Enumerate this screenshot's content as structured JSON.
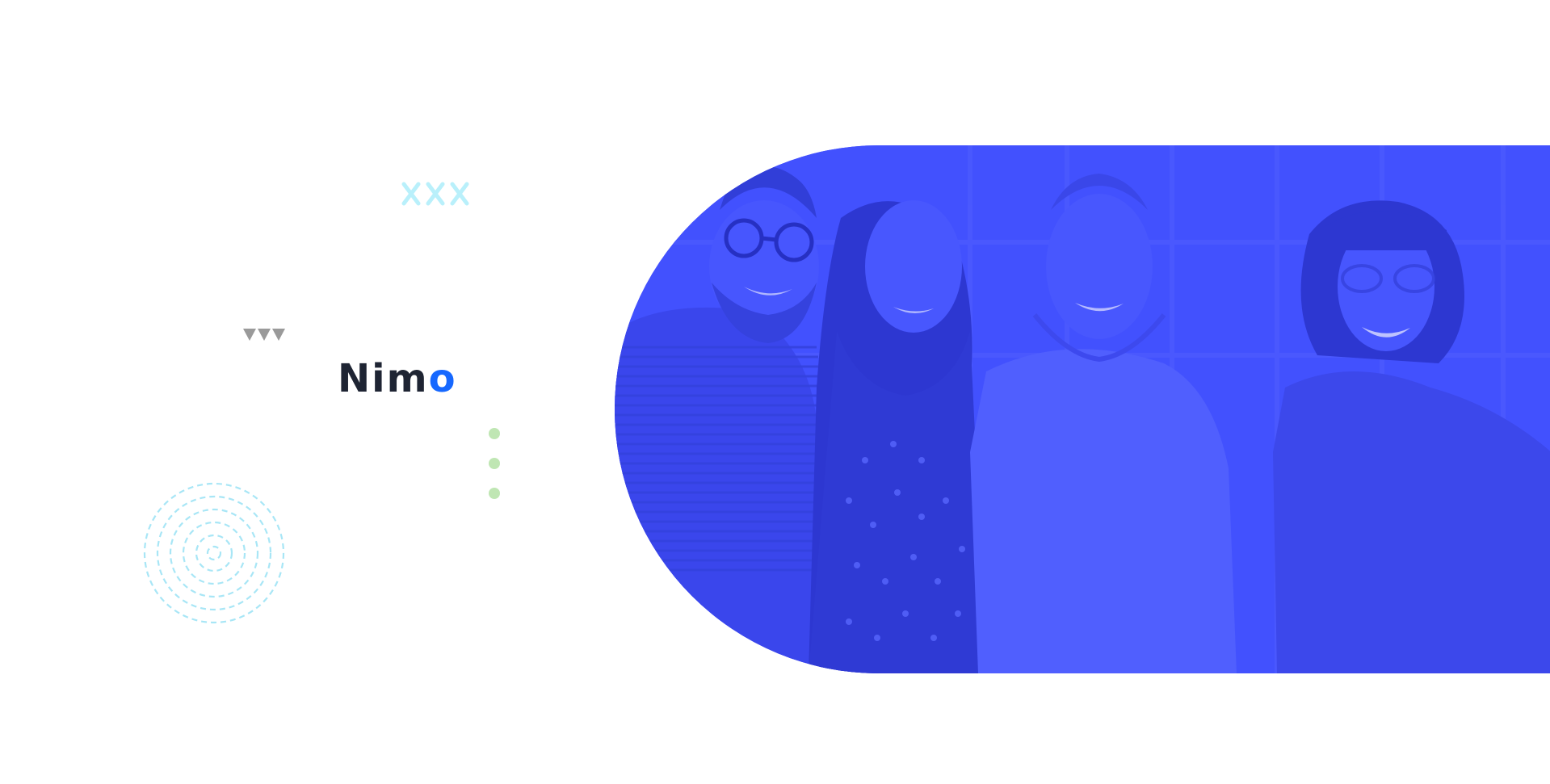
{
  "brand": {
    "text_main": "Nim",
    "text_accent": "o",
    "color_main": "#1e2433",
    "color_accent": "#1668ff"
  },
  "decorations": {
    "cross_row_icon": "cross-row-icon",
    "triangle_row_icon": "triangle-row-icon",
    "dot_column_icon": "dot-column-icon",
    "concentric_rings_icon": "concentric-rings-icon",
    "cross_color": "#b9f0fb",
    "triangle_color": "#9a9a9a",
    "dot_color": "#bfe6b3",
    "ring_color": "#a8e6f6"
  },
  "hero": {
    "image_icon": "team-photo-image",
    "overlay_color": "#3f4cf8"
  }
}
